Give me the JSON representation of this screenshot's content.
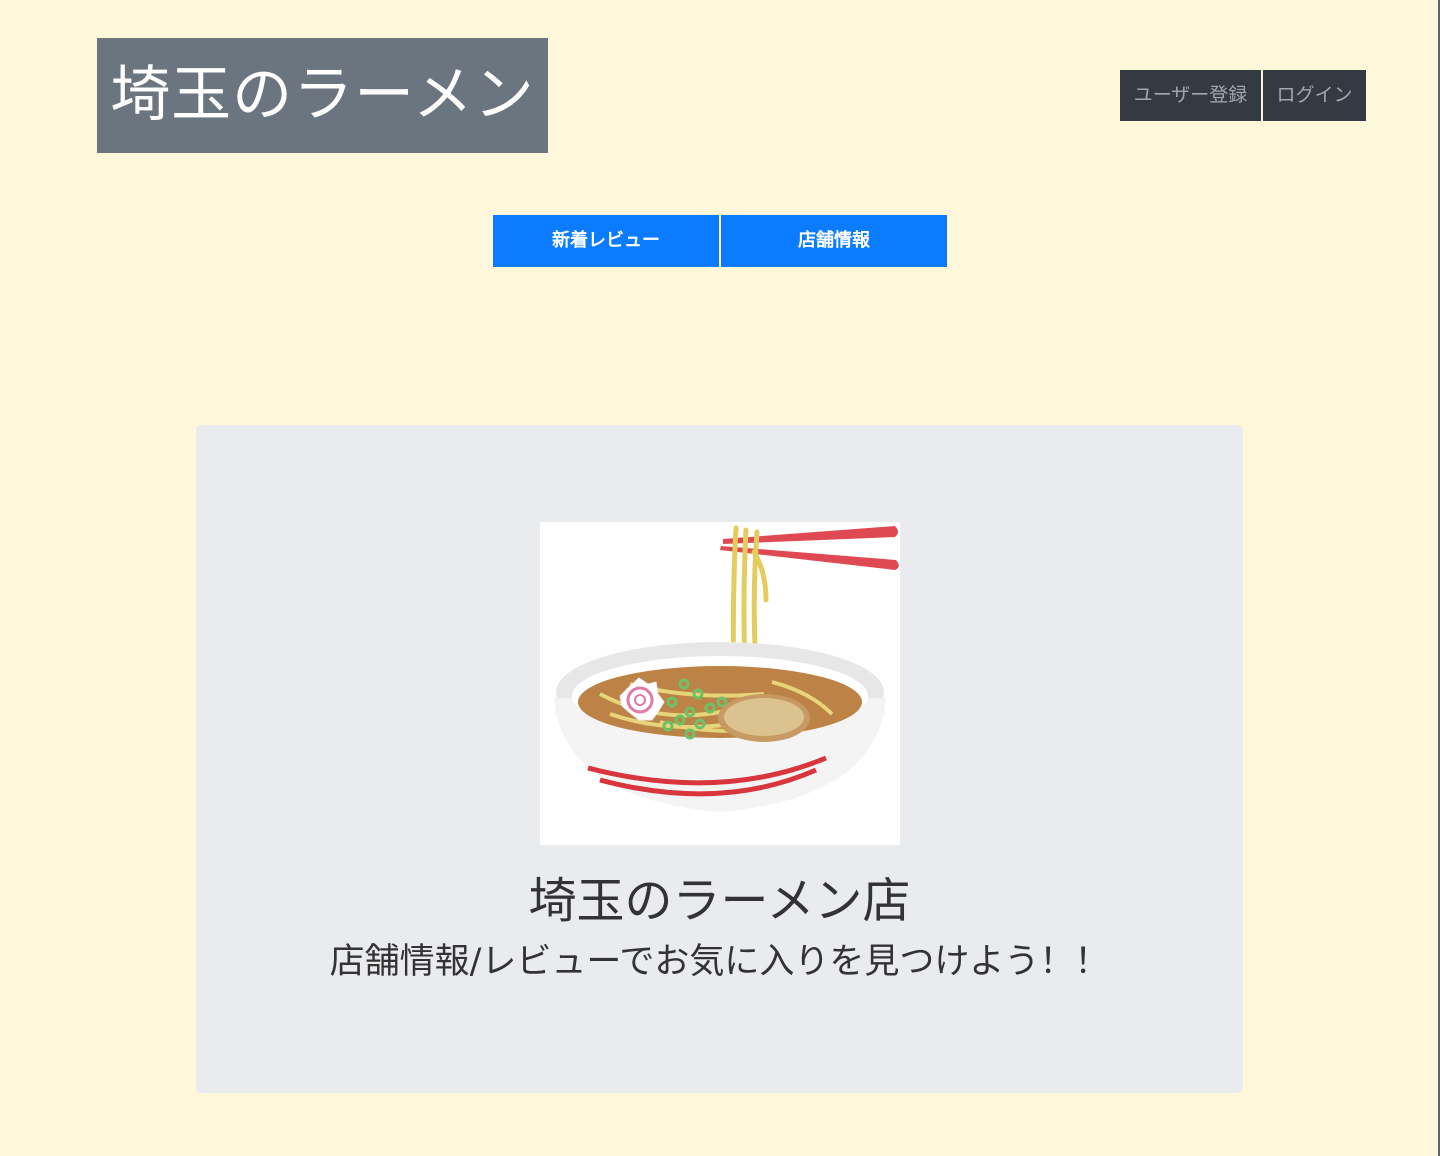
{
  "header": {
    "site_title": "埼玉のラーメン",
    "register_label": "ユーザー登録",
    "login_label": "ログイン"
  },
  "nav": {
    "new_reviews_label": "新着レビュー",
    "shop_info_label": "店舗情報"
  },
  "hero": {
    "title": "埼玉のラーメン店",
    "subtitle": "店舗情報/レビューでお気に入りを見つけよう！！"
  },
  "colors": {
    "page_background": "#fff7da",
    "logo_background": "#6b7580",
    "auth_button_background": "#343a41",
    "nav_button_background": "#0b7cff",
    "hero_background": "#e9ebef"
  }
}
